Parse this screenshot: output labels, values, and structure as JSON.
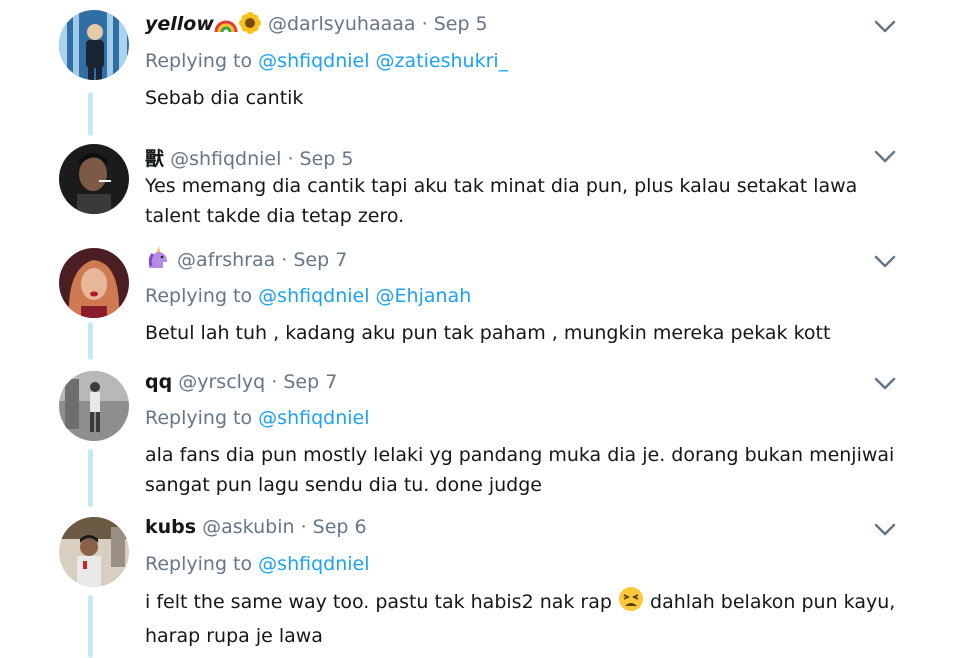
{
  "tweets": [
    {
      "name": "yellow",
      "handle": "@darlsyuhaaaa",
      "date": "Sep 5",
      "replying_label": "Replying to",
      "mentions": [
        "@shfiqdniel",
        "@zatieshukri_"
      ],
      "text": "Sebab dia cantik"
    },
    {
      "name": "獸",
      "handle": "@shfiqdniel",
      "date": "Sep 5",
      "text": "Yes memang dia cantik tapi aku tak minat dia pun, plus kalau setakat lawa talent takde dia tetap zero."
    },
    {
      "name": "",
      "handle": "@afrshraa",
      "date": "Sep 7",
      "replying_label": "Replying to",
      "mentions": [
        "@shfiqdniel",
        "@Ehjanah"
      ],
      "text": "Betul lah tuh , kadang aku pun tak paham , mungkin mereka pekak kott"
    },
    {
      "name": "qq",
      "handle": "@yrsclyq",
      "date": "Sep 7",
      "replying_label": "Replying to",
      "mentions": [
        "@shfiqdniel"
      ],
      "text": "ala fans dia pun mostly lelaki yg pandang muka dia je. dorang bukan menjiwai sangat pun lagu sendu dia tu. done judge"
    },
    {
      "name": "kubs",
      "handle": "@askubin",
      "date": "Sep 6",
      "replying_label": "Replying to",
      "mentions": [
        "@shfiqdniel"
      ],
      "text_before_emoji": "i felt the same way too. pastu tak habis2 nak rap",
      "text_after_emoji": "dahlah belakon pun kayu,",
      "text_line2": "harap rupa je lawa"
    }
  ],
  "separator": "·",
  "icons": {
    "name_emoji_1": "rainbow-icon",
    "name_emoji_2": "sunflower-icon",
    "name_emoji_3": "unicorn-icon",
    "inline_emoji": "tired-face-icon",
    "caret": "chevron-down-icon"
  },
  "colors": {
    "link": "#1da1f2",
    "muted": "#657786",
    "thread": "#c4eaf7",
    "text": "#14171a"
  }
}
